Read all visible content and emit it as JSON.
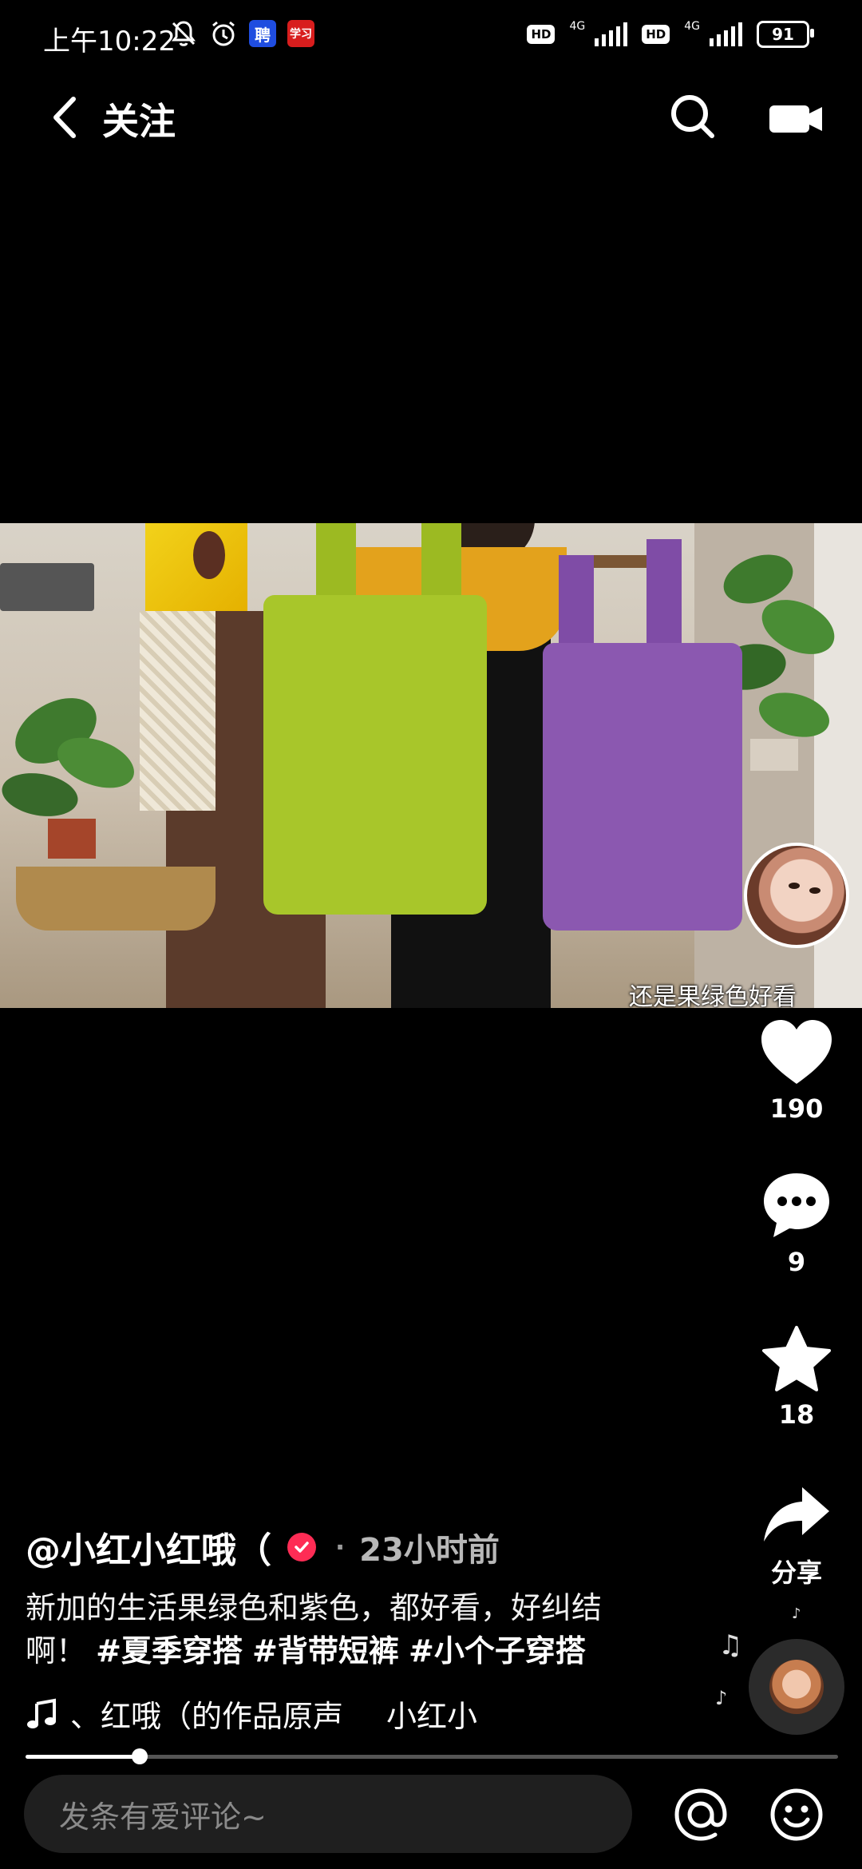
{
  "status_bar": {
    "time": "上午10:22",
    "app_badge_1": "聘",
    "app_badge_2": "学习",
    "hd_1": "HD",
    "net_1": "4G",
    "hd_2": "HD",
    "net_2": "4G",
    "battery": "91"
  },
  "header": {
    "title": "关注"
  },
  "video": {
    "subtitle": "还是果绿色好看"
  },
  "actions": {
    "like_count": "190",
    "comment_count": "9",
    "favorite_count": "18",
    "share_label": "分享"
  },
  "post": {
    "author": "@小红小红哦（",
    "dot": "·",
    "time": "23小时前",
    "description_text": "新加的生活果绿色和紫色，都好看，好纠结啊！",
    "hashtags": [
      "#夏季穿搭",
      "#背带短裤",
      "#小个子穿搭"
    ]
  },
  "music": {
    "title": "、红哦（的作品原声",
    "author": "小红小"
  },
  "progress": {
    "fraction": 0.14
  },
  "comment_bar": {
    "placeholder": "发条有爱评论~"
  }
}
